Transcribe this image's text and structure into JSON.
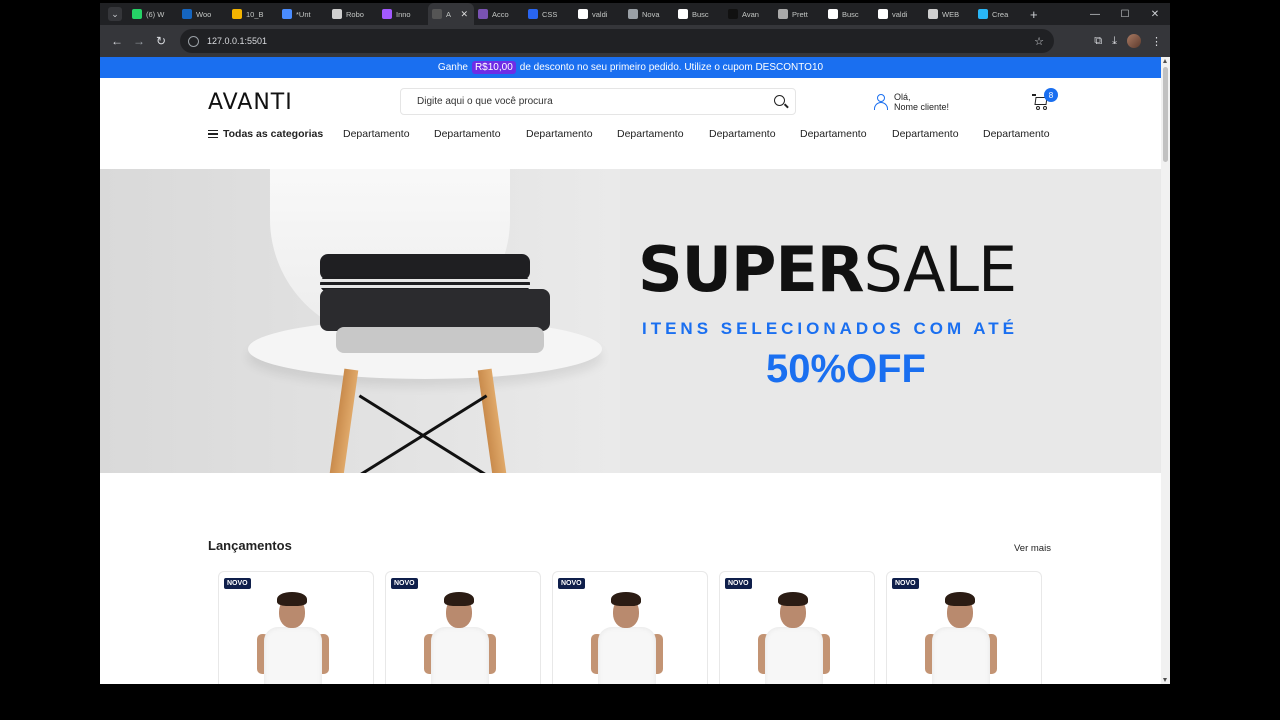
{
  "browser": {
    "tabs": [
      {
        "label": "(6) W",
        "color": "#25d366"
      },
      {
        "label": "Woo",
        "color": "#1565c0"
      },
      {
        "label": "10_B",
        "color": "#f4b400"
      },
      {
        "label": "*Unt",
        "color": "#4a8cff"
      },
      {
        "label": "Robo",
        "color": "#cfcfcf"
      },
      {
        "label": "Inno",
        "color": "#a259ff"
      },
      {
        "label": "A",
        "color": "#555555",
        "active": true
      },
      {
        "label": "Acco",
        "color": "#7952b3"
      },
      {
        "label": "CSS",
        "color": "#2965f1"
      },
      {
        "label": "valdi",
        "color": "#ffffff"
      },
      {
        "label": "Nova",
        "color": "#9aa0a6"
      },
      {
        "label": "Busc",
        "color": "#ffffff"
      },
      {
        "label": "Avan",
        "color": "#111111"
      },
      {
        "label": "Prett",
        "color": "#aaaaaa"
      },
      {
        "label": "Busc",
        "color": "#ffffff"
      },
      {
        "label": "valdi",
        "color": "#ffffff"
      },
      {
        "label": "WEB",
        "color": "#cfcfcf"
      },
      {
        "label": "Crea",
        "color": "#29b6f6"
      }
    ],
    "url": "127.0.0.1:5501"
  },
  "promo": {
    "before": "Ganhe",
    "coupon_value": "R$10,00",
    "after": "de desconto no seu primeiro pedido. Utilize o cupom DESCONTO10"
  },
  "header": {
    "logo": "AVANTI",
    "search_placeholder": "Digite aqui o que você procura",
    "greeting": "Olá,",
    "user_name": "Nome cliente!",
    "cart_count": "8"
  },
  "nav": {
    "all_categories": "Todas as categorias",
    "departments": [
      "Departamento",
      "Departamento",
      "Departamento",
      "Departamento",
      "Departamento",
      "Departamento",
      "Departamento",
      "Departamento"
    ]
  },
  "hero": {
    "title_bold": "SUPER",
    "title_light": "SALE",
    "subtitle": "ITENS SELECIONADOS COM ATÉ",
    "discount": "50%OFF"
  },
  "launches": {
    "title": "Lançamentos",
    "see_more": "Ver mais",
    "badge": "NOVO",
    "card_count": 5
  },
  "colors": {
    "accent": "#1a6ff0",
    "coupon": "#6e2de6",
    "badge": "#0f1f4b"
  }
}
